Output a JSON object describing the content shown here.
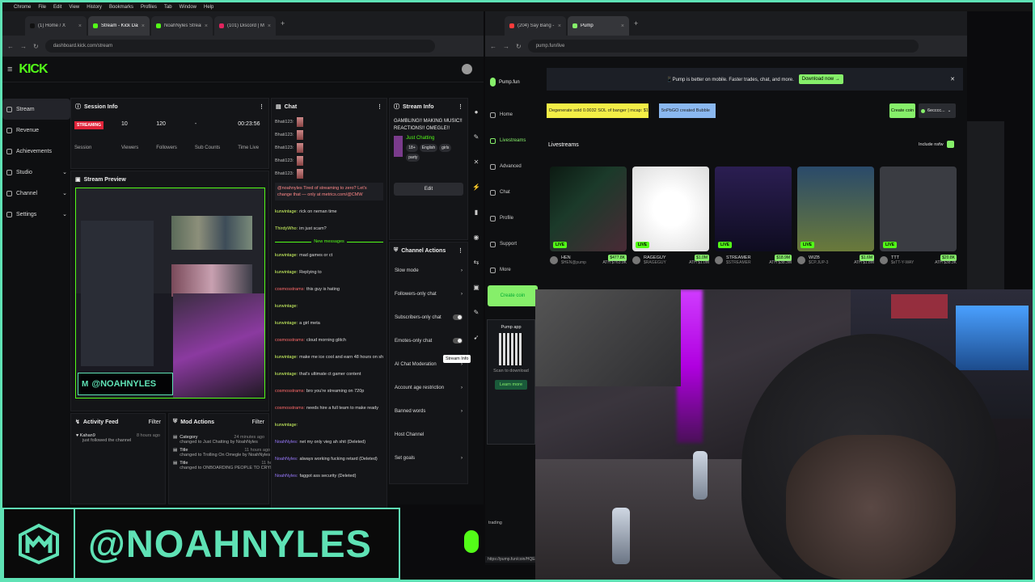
{
  "menubar": [
    "Chrome",
    "File",
    "Edit",
    "View",
    "History",
    "Bookmarks",
    "Profiles",
    "Tab",
    "Window",
    "Help"
  ],
  "left_browser": {
    "tabs": [
      {
        "label": "(1) Home / X",
        "color": "#111111"
      },
      {
        "label": "Stream - Kick Dashboard",
        "color": "#53fc18",
        "active": true
      },
      {
        "label": "NoahNyles Stream - Watch...",
        "color": "#53fc18"
      },
      {
        "label": "(101) Discord | Memecoin...",
        "color": "#e0245e"
      }
    ],
    "url": "dashboard.kick.com/stream",
    "brand": "KICK",
    "sidebar": [
      {
        "label": "Stream",
        "active": true
      },
      {
        "label": "Revenue"
      },
      {
        "label": "Achievements"
      },
      {
        "label": "Studio",
        "chevron": true
      },
      {
        "label": "Channel",
        "chevron": true
      },
      {
        "label": "Settings",
        "chevron": true
      }
    ],
    "session_info": {
      "title": "Session Info",
      "badge": "STREAMING",
      "stats": [
        {
          "value": "10",
          "label": "Viewers"
        },
        {
          "value": "120",
          "label": "Followers"
        },
        {
          "value": "-",
          "label": "Sub Counts"
        },
        {
          "value": "00:23:56",
          "label": "Time Live"
        }
      ],
      "session_label": "Session"
    },
    "preview": {
      "title": "Stream Preview",
      "overlay_handle": "@NOAHNYLES"
    },
    "activity_feed": {
      "title": "Activity Feed",
      "filter": "Filter",
      "items": [
        {
          "user": "Kahan9",
          "time": "8 hours ago",
          "text": "just followed the channel"
        }
      ]
    },
    "mod_actions": {
      "title": "Mod Actions",
      "filter": "Filter",
      "items": [
        {
          "title": "Category",
          "time": "24 minutes ago",
          "text": "changed to Just Chatting by NoahNyles"
        },
        {
          "title": "Title",
          "time": "11 hours ago",
          "text": "changed to Trolling On Omegle by NoahNyles"
        },
        {
          "title": "Title",
          "time": "11 hours ago",
          "text": "changed to ONBOARDING PEOPLE TO CRYPTO ON"
        }
      ]
    },
    "chat": {
      "title": "Chat",
      "top_users": [
        "Bhati123:",
        "Bhati123:",
        "Bhati123:",
        "Bhati123:",
        "Bhati123:"
      ],
      "highlight": "@noahnyles Tired of streaming to zero? Let's change that — only at metrics.com/@CMW",
      "lines": [
        {
          "user": "kurwintage:",
          "text": "rick on neman time",
          "cls": "u1"
        },
        {
          "user": "ThirdyWho:",
          "text": "im just scam?",
          "cls": "u1"
        },
        {
          "user": "kurwintage:",
          "text": "mad games or ct",
          "cls": "u1"
        },
        {
          "user": "kurwintage:",
          "text": "Replying to",
          "cls": "u1"
        },
        {
          "user": "cosmosstrams:",
          "text": "this guy is hating",
          "cls": "u2"
        },
        {
          "user": "kurwintage:",
          "text": "",
          "cls": "u1"
        },
        {
          "user": "kurwintage:",
          "text": "a girl meta",
          "cls": "u1"
        },
        {
          "user": "cosmosstrams:",
          "text": "cloud morning glitch",
          "cls": "u2"
        },
        {
          "user": "kurwintage:",
          "text": "make me ice cool and earn 48 hours on shifts",
          "cls": "u1"
        },
        {
          "user": "kurwintage:",
          "text": "that's ultimate ct gamer content",
          "cls": "u1"
        },
        {
          "user": "cosmosstrams:",
          "text": "bro you're streaming on 720p",
          "cls": "u2"
        },
        {
          "user": "cosmosstrams:",
          "text": "needs hire a full team to make ready",
          "cls": "u2"
        },
        {
          "user": "kurwintage:",
          "text": "",
          "cls": "u1"
        },
        {
          "user": "NoahNyles:",
          "text": "net my only vieg ah shit (Deleted)",
          "cls": "u3"
        },
        {
          "user": "NoahNyles:",
          "text": "always working fucking retard (Deleted)",
          "cls": "u3"
        },
        {
          "user": "NoahNyles:",
          "text": "faggot ass security (Deleted)",
          "cls": "u3"
        }
      ],
      "new_messages": "New messages"
    },
    "stream_info": {
      "title": "Stream Info",
      "stream_title": "GAMBLING!! MAKING MUSIC!! REACTIONS!! OMEGLE!!",
      "category": "Just Chatting",
      "tags": [
        "18+",
        "English",
        "girls",
        "party"
      ],
      "edit": "Edit"
    },
    "channel_actions": {
      "title": "Channel Actions",
      "items": [
        {
          "label": "Slow mode",
          "kind": "chevron"
        },
        {
          "label": "Followers-only chat",
          "kind": "chevron"
        },
        {
          "label": "Subscribers-only chat",
          "kind": "toggle"
        },
        {
          "label": "Emotes-only chat",
          "kind": "toggle"
        },
        {
          "label": "AI Chat Moderation",
          "kind": "chevron"
        },
        {
          "label": "Account age restriction",
          "kind": "chevron"
        },
        {
          "label": "Banned words",
          "kind": "chevron"
        },
        {
          "label": "Host Channel",
          "kind": "none"
        },
        {
          "label": "Set goals",
          "kind": "chevron"
        }
      ],
      "tooltip": "Stream Info"
    }
  },
  "right_browser": {
    "tabs": [
      {
        "label": "(204) Say Bang - Plubb Jerk...",
        "color": "#ff3b3b"
      },
      {
        "label": "Pump",
        "color": "#86ef6a",
        "active": true
      }
    ],
    "url": "pump.fun/live",
    "brand": "Pump.fun",
    "sidebar": [
      "Home",
      "Livestreams",
      "Advanced",
      "Chat",
      "Profile",
      "Support",
      "More"
    ],
    "create_coin": "Create coin",
    "banner_text": "📱Pump is better on mobile. Faster trades, chat, and more.",
    "download": "Download now →",
    "ticker_yellow": "Degenerate sold 0.0032 SOL of banger  | mcap: $10.4K",
    "ticker_blue": "5nPbGO created Bubble",
    "header_create": "Create coin",
    "header_user": "6ecccc...",
    "livestreams_title": "Livestreams",
    "include_nsfw": "Include nsfw",
    "live": "LIVE",
    "cards": [
      {
        "name": "HEN",
        "sub": "$HEN@pump",
        "mcap": "$477.8K",
        "ath": "ATH $763.9K"
      },
      {
        "name": "RAGEGUY",
        "sub": "$RAGEGUY",
        "mcap": "$1.0M",
        "ath": "ATH $1.0M"
      },
      {
        "name": "STREAMER",
        "sub": "$STREAMER",
        "mcap": "$18.9M",
        "ath": "ATH $38.3M"
      },
      {
        "name": "WIZB",
        "sub": "$CP.JUP-3",
        "mcap": "$1.6M",
        "ath": "ATH $1.8M"
      },
      {
        "name": "TTT",
        "sub": "$sTT-Y-WAY",
        "mcap": "$20.8K",
        "ath": "ATH $38.3K"
      }
    ],
    "pump_app": "Pump app",
    "scan_to_download": "Scan to download",
    "learn_more": "Learn more",
    "bottom_left": "trading",
    "status_url": "https://pump.fun/coin/HQEgJ9t..."
  },
  "overlay_handle": "@NOAHNYLES"
}
